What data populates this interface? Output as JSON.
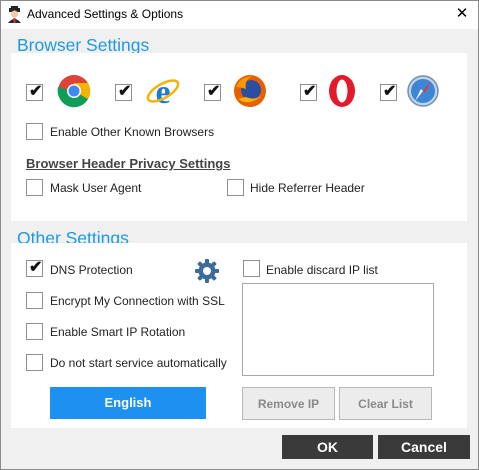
{
  "window": {
    "title": "Advanced Settings & Options",
    "close_glyph": "✕",
    "app_icon": "user-avatar-icon"
  },
  "browser_settings": {
    "title": "Browser Settings",
    "browsers": [
      {
        "name": "chrome-icon",
        "checked": true
      },
      {
        "name": "internet-explorer-icon",
        "checked": true
      },
      {
        "name": "firefox-icon",
        "checked": true
      },
      {
        "name": "opera-icon",
        "checked": true
      },
      {
        "name": "safari-icon",
        "checked": true
      }
    ],
    "enable_other_label": "Enable Other Known Browsers",
    "header_privacy_title": "Browser Header Privacy Settings",
    "mask_user_agent_label": "Mask User Agent",
    "hide_referrer_label": "Hide Referrer Header"
  },
  "other_settings": {
    "title": "Other Settings",
    "dns_protection_label": "DNS Protection",
    "encrypt_label": "Encrypt My Connection with SSL",
    "smart_ip_label": "Enable Smart IP Rotation",
    "no_autostart_label": "Do not start service automatically",
    "discard_ip_label": "Enable discard IP list",
    "language_button": "English",
    "remove_ip_button": "Remove IP",
    "clear_list_button": "Clear List",
    "settings_icon": "gear-icon"
  },
  "footer": {
    "ok_label": "OK",
    "cancel_label": "Cancel"
  },
  "checkbox_glyph": "✔",
  "colors": {
    "accent": "#1e9ae0",
    "primary_button": "#1e90ef",
    "dark_button": "#3a3a3a"
  }
}
